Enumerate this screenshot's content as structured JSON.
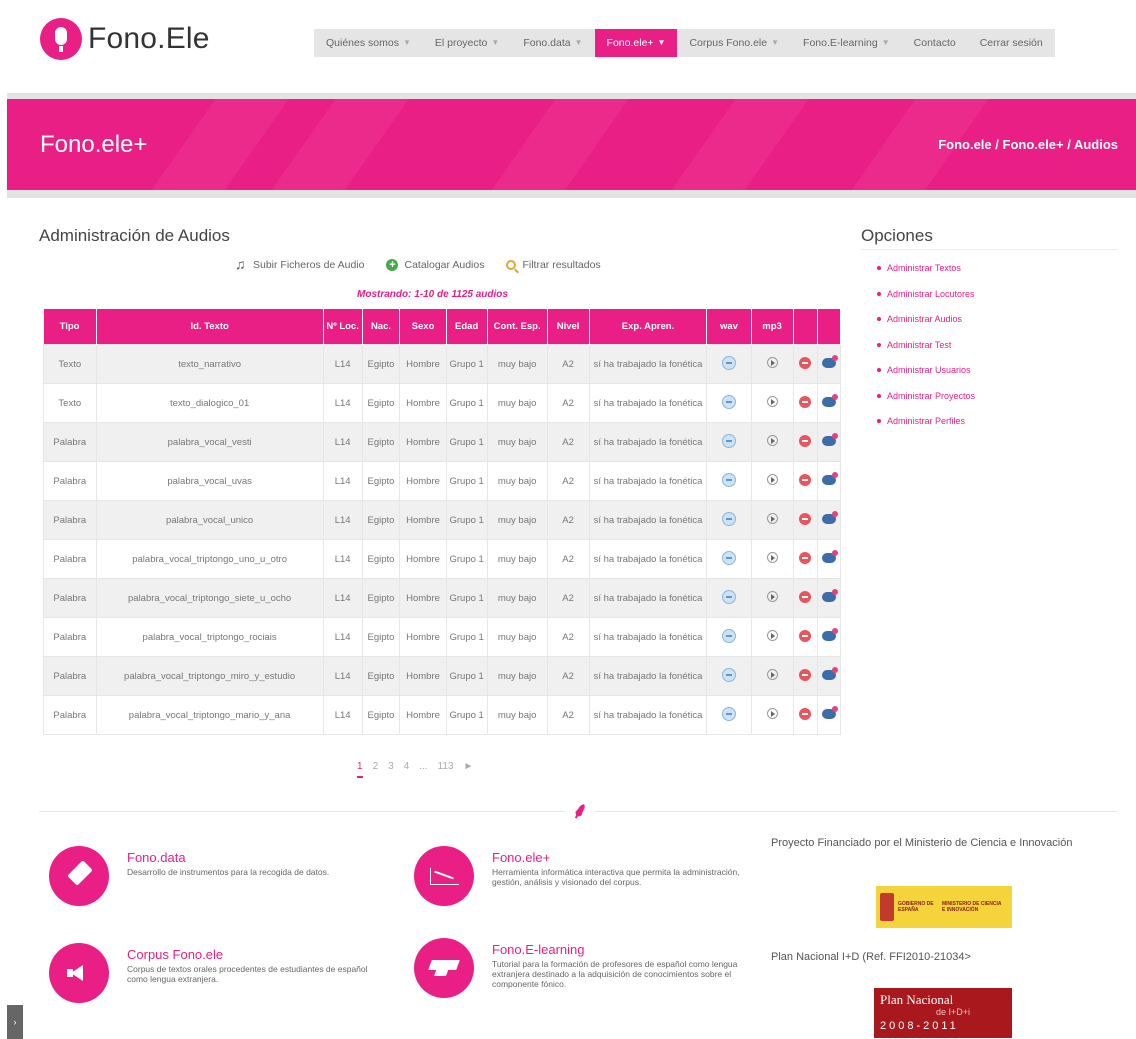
{
  "brand": {
    "name": "Fono.Ele"
  },
  "nav": {
    "items": [
      {
        "label": "Quiénes somos",
        "caret": true
      },
      {
        "label": "El proyecto",
        "caret": true
      },
      {
        "label": "Fono.data",
        "caret": true
      },
      {
        "label": "Fono.ele+",
        "caret": true,
        "active": true
      },
      {
        "label": "Corpus Fono.ele",
        "caret": true
      },
      {
        "label": "Fono.E-learning",
        "caret": true
      },
      {
        "label": "Contacto",
        "caret": false
      },
      {
        "label": "Cerrar sesión",
        "caret": false
      }
    ]
  },
  "banner": {
    "title": "Fono.ele+",
    "breadcrumb": [
      "Fono.ele",
      "Fono.ele+",
      "Audios"
    ]
  },
  "main": {
    "title": "Administración de Audios",
    "actions": {
      "upload": "Subir Ficheros de Audio",
      "catalog": "Catalogar Audios",
      "filter": "Filtrar resultados"
    },
    "showing": "Mostrando: 1-10 de 1125 audios"
  },
  "table": {
    "headers": [
      "Tipo",
      "Id. Texto",
      "Nº Loc.",
      "Nac.",
      "Sexo",
      "Edad",
      "Cont. Esp.",
      "Nivel",
      "Exp. Apren.",
      "wav",
      "mp3",
      "",
      ""
    ],
    "rows": [
      [
        "Texto",
        "texto_narrativo",
        "L14",
        "Egipto",
        "Hombre",
        "Grupo 1",
        "muy bajo",
        "A2",
        "sí ha trabajado la fonética"
      ],
      [
        "Texto",
        "texto_dialogico_01",
        "L14",
        "Egipto",
        "Hombre",
        "Grupo 1",
        "muy bajo",
        "A2",
        "sí ha trabajado la fonética"
      ],
      [
        "Palabra",
        "palabra_vocal_vesti",
        "L14",
        "Egipto",
        "Hombre",
        "Grupo 1",
        "muy bajo",
        "A2",
        "sí ha trabajado la fonética"
      ],
      [
        "Palabra",
        "palabra_vocal_uvas",
        "L14",
        "Egipto",
        "Hombre",
        "Grupo 1",
        "muy bajo",
        "A2",
        "sí ha trabajado la fonética"
      ],
      [
        "Palabra",
        "palabra_vocal_unico",
        "L14",
        "Egipto",
        "Hombre",
        "Grupo 1",
        "muy bajo",
        "A2",
        "sí ha trabajado la fonética"
      ],
      [
        "Palabra",
        "palabra_vocal_triptongo_uno_u_otro",
        "L14",
        "Egipto",
        "Hombre",
        "Grupo 1",
        "muy bajo",
        "A2",
        "sí ha trabajado la fonética"
      ],
      [
        "Palabra",
        "palabra_vocal_triptongo_siete_u_ocho",
        "L14",
        "Egipto",
        "Hombre",
        "Grupo 1",
        "muy bajo",
        "A2",
        "sí ha trabajado la fonética"
      ],
      [
        "Palabra",
        "palabra_vocal_triptongo_rociais",
        "L14",
        "Egipto",
        "Hombre",
        "Grupo 1",
        "muy bajo",
        "A2",
        "sí ha trabajado la fonética"
      ],
      [
        "Palabra",
        "palabra_vocal_triptongo_miro_y_estudio",
        "L14",
        "Egipto",
        "Hombre",
        "Grupo 1",
        "muy bajo",
        "A2",
        "sí ha trabajado la fonética"
      ],
      [
        "Palabra",
        "palabra_vocal_triptongo_mario_y_ana",
        "L14",
        "Egipto",
        "Hombre",
        "Grupo 1",
        "muy bajo",
        "A2",
        "sí ha trabajado la fonética"
      ]
    ]
  },
  "pagination": {
    "pages": [
      "1",
      "2",
      "3",
      "4",
      "...",
      "113"
    ],
    "next": "►",
    "current": "1"
  },
  "sidebar": {
    "title": "Opciones",
    "items": [
      "Administrar Textos",
      "Administrar Locutores",
      "Administrar Audios",
      "Administrar Test",
      "Administrar Usuarios",
      "Administrar Proyectos",
      "Administrar Perfiles"
    ]
  },
  "footer": {
    "features": [
      {
        "title": "Fono.data",
        "desc": "Desarrollo de instrumentos para la recogida de datos.",
        "icon": "tag-icon"
      },
      {
        "title": "Fono.ele+",
        "desc": "Herramienta informática interactiva que permita la administración, gestión, análisis y visionado del corpus.",
        "icon": "chart-icon"
      },
      {
        "title": "Corpus Fono.ele",
        "desc": "Corpus de textos orales procedentes de estudiantes de español como lengua extranjera.",
        "icon": "speaker-icon"
      },
      {
        "title": "Fono.E-learning",
        "desc": "Tutorial para la formación de profesores de español como lengua extranjera destinado a la adquisición de conocimientos sobre el componente fónico.",
        "icon": "graduation-cap-icon"
      }
    ],
    "funding_title": "Proyecto Financiado por el Ministerio de Ciencia e Innovación",
    "gov_logo": {
      "left": "GOBIERNO DE ESPAÑA",
      "right": "MINISTERIO DE CIENCIA E INNOVACIÓN"
    },
    "plan_label": "Plan Nacional I+D (Ref. FFI2010-21034>",
    "plan_logo": {
      "line1": "Plan Nacional",
      "line2": "de I+D+i",
      "line3": "2008-2011"
    }
  },
  "colors": {
    "accent": "#ea1f85",
    "nav_bg": "#e5e5e5"
  },
  "sidetab": {
    "label": "›"
  }
}
